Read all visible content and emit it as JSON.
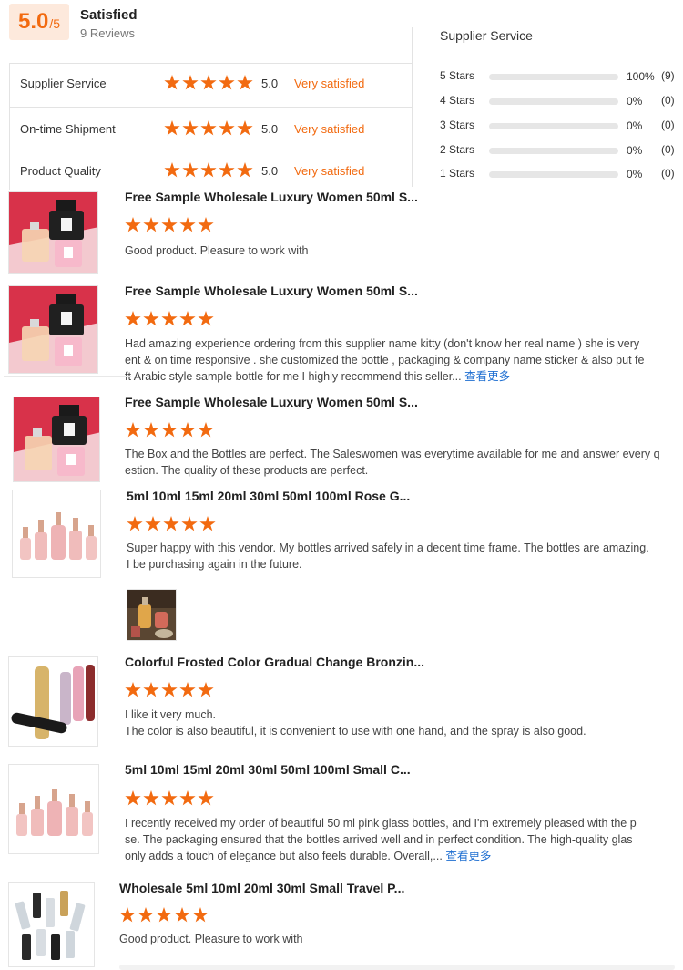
{
  "summary": {
    "score": "5.0",
    "score_of": "/5",
    "label": "Satisfied",
    "count": "9 Reviews"
  },
  "categories": [
    {
      "name": "Supplier Service",
      "score": "5.0",
      "text": "Very satisfied"
    },
    {
      "name": "On-time Shipment",
      "score": "5.0",
      "text": "Very satisfied"
    },
    {
      "name": "Product Quality",
      "score": "5.0",
      "text": "Very satisfied"
    }
  ],
  "distribution": {
    "title": "Supplier Service",
    "rows": [
      {
        "label": "5 Stars",
        "pct": "100%",
        "count": "(9)",
        "fraction": 1.0
      },
      {
        "label": "4 Stars",
        "pct": "0%",
        "count": "(0)",
        "fraction": 0
      },
      {
        "label": "3 Stars",
        "pct": "0%",
        "count": "(0)",
        "fraction": 0
      },
      {
        "label": "2 Stars",
        "pct": "0%",
        "count": "(0)",
        "fraction": 0
      },
      {
        "label": "1 Stars",
        "pct": "0%",
        "count": "(0)",
        "fraction": 0
      }
    ]
  },
  "star_color": "#f26a10",
  "reviews": [
    {
      "title": "Free Sample Wholesale Luxury Women 50ml S...",
      "rating": 5,
      "lines": [
        "Good product. Pleasure to work with"
      ],
      "more": ""
    },
    {
      "title": "Free Sample Wholesale Luxury Women 50ml S...",
      "rating": 5,
      "lines": [
        "Had amazing experience ordering from this supplier name kitty (don't know her real name ) she is very",
        "ent & on time responsive . she customized the bottle , packaging & company name sticker & also put fe",
        "ft Arabic style  sample bottle for me I highly recommend this seller..."
      ],
      "more": "查看更多"
    },
    {
      "title": "Free Sample Wholesale Luxury Women 50ml S...",
      "rating": 5,
      "lines": [
        "The Box and the Bottles are perfect. The Saleswomen was everytime available for me and answer every q",
        "estion. The quality of these products are perfect."
      ],
      "more": ""
    },
    {
      "title": "5ml 10ml 15ml 20ml 30ml 50ml 100ml Rose G...",
      "rating": 5,
      "lines": [
        "Super happy with this vendor. My bottles arrived safely in a decent time frame. The bottles are amazing.",
        "I be purchasing again in the future."
      ],
      "more": ""
    },
    {
      "title": "Colorful Frosted Color Gradual Change Bronzin...",
      "rating": 5,
      "lines": [
        "I like it very much.",
        "The color is also beautiful, it is convenient to use with one hand, and the spray is also good."
      ],
      "more": ""
    },
    {
      "title": "5ml 10ml 15ml 20ml 30ml 50ml 100ml Small C...",
      "rating": 5,
      "lines": [
        "I recently received my order of beautiful 50 ml pink glass bottles, and I'm extremely pleased with the p",
        "se. The packaging ensured that the bottles arrived well and in perfect condition. The high-quality glas",
        "only adds a touch of elegance but also feels durable. Overall,..."
      ],
      "more": "查看更多"
    },
    {
      "title": "Wholesale 5ml 10ml 20ml 30ml Small Travel P...",
      "rating": 5,
      "lines": [
        "Good product. Pleasure to work with"
      ],
      "more": ""
    }
  ]
}
